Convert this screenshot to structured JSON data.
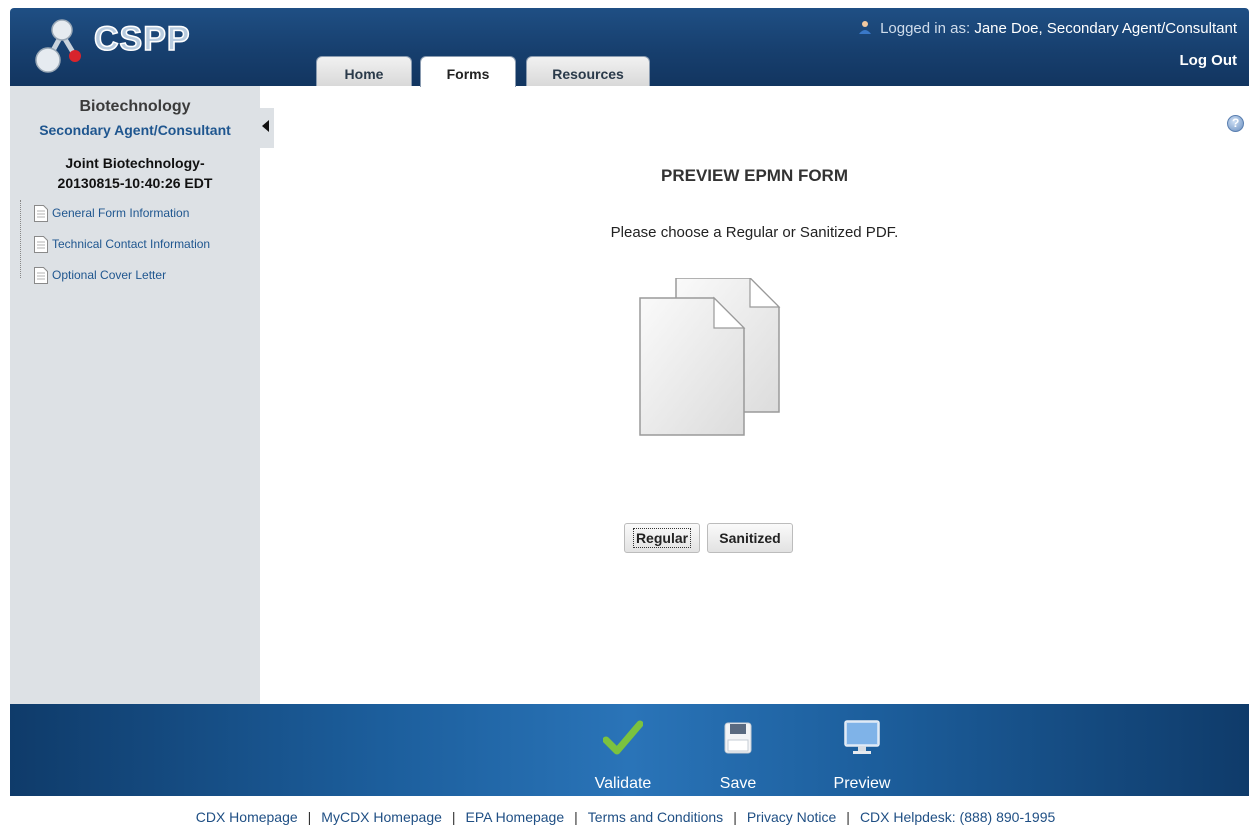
{
  "header": {
    "logo_text": "CSPP",
    "tabs": [
      {
        "label": "Home"
      },
      {
        "label": "Forms"
      },
      {
        "label": "Resources"
      }
    ],
    "logged_in_prefix": "Logged in as:",
    "user": "Jane Doe, Secondary Agent/Consultant",
    "logout": "Log Out"
  },
  "sidebar": {
    "title": "Biotechnology",
    "role": "Secondary Agent/Consultant",
    "form_line1": "Joint Biotechnology-",
    "form_line2": "20130815-10:40:26 EDT",
    "items": [
      {
        "label": "General Form Information"
      },
      {
        "label": "Technical Contact Information"
      },
      {
        "label": "Optional Cover Letter"
      }
    ]
  },
  "main": {
    "title": "PREVIEW EPMN FORM",
    "prompt": "Please choose a Regular or Sanitized PDF.",
    "buttons": {
      "regular": "Regular",
      "sanitized": "Sanitized"
    }
  },
  "footer_bar": {
    "validate": "Validate",
    "save": "Save",
    "preview": "Preview"
  },
  "links": [
    "CDX Homepage",
    "MyCDX Homepage",
    "EPA Homepage",
    "Terms and Conditions",
    "Privacy Notice",
    "CDX Helpdesk: (888) 890-1995"
  ],
  "colors": {
    "header_blue": "#1f4f84",
    "link_blue": "#1f568f",
    "sidebar_bg": "#dde1e5",
    "validate_green": "#7bc23f"
  },
  "icons": [
    "user-icon",
    "collapse-arrow-icon",
    "document-icon",
    "help-icon",
    "documents-icon",
    "checkmark-icon",
    "floppy-disk-icon",
    "monitor-icon"
  ]
}
